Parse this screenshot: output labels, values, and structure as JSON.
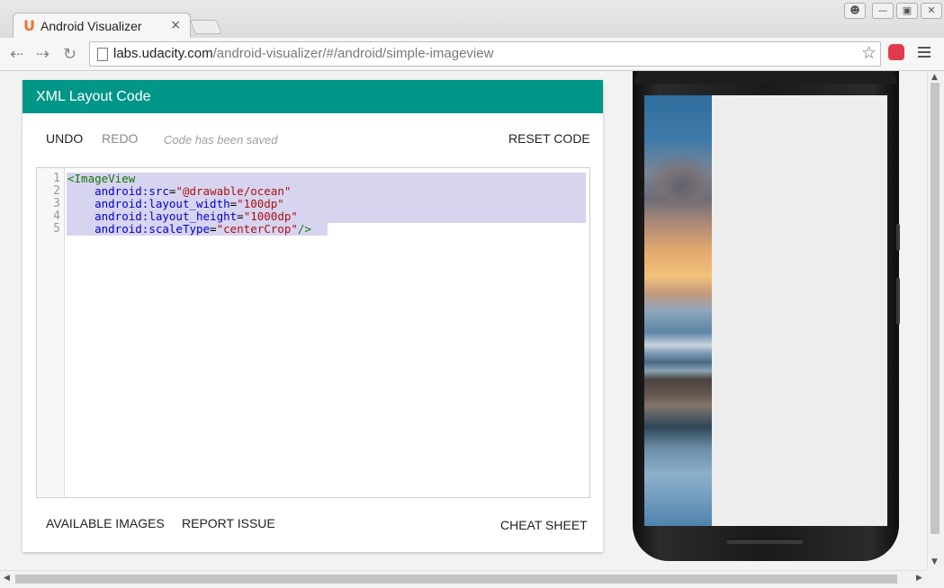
{
  "browser": {
    "tab_title": "Android Visualizer",
    "tab_favicon": "U",
    "tab_close": "×",
    "url_host": "labs.udacity.com",
    "url_path": "/android-visualizer/#/android/simple-imageview"
  },
  "card": {
    "header_title": "XML Layout Code",
    "undo_label": "UNDO",
    "redo_label": "REDO",
    "saved_status": "Code has been saved",
    "reset_label": "RESET CODE",
    "available_images_label": "AVAILABLE IMAGES",
    "report_issue_label": "REPORT ISSUE",
    "cheat_sheet_label": "CHEAT SHEET"
  },
  "editor": {
    "line_numbers": [
      "1",
      "2",
      "3",
      "4",
      "5"
    ],
    "lines": [
      [
        {
          "t": "tag",
          "v": "<ImageView"
        }
      ],
      [
        {
          "t": "plain",
          "v": "    "
        },
        {
          "t": "attr",
          "v": "android:src"
        },
        {
          "t": "plain",
          "v": "="
        },
        {
          "t": "str",
          "v": "\"@drawable/ocean\""
        }
      ],
      [
        {
          "t": "plain",
          "v": "    "
        },
        {
          "t": "attr",
          "v": "android:layout_width"
        },
        {
          "t": "plain",
          "v": "="
        },
        {
          "t": "str",
          "v": "\"100dp\""
        }
      ],
      [
        {
          "t": "plain",
          "v": "    "
        },
        {
          "t": "attr",
          "v": "android:layout_height"
        },
        {
          "t": "plain",
          "v": "="
        },
        {
          "t": "str",
          "v": "\"1000dp\""
        }
      ],
      [
        {
          "t": "plain",
          "v": "    "
        },
        {
          "t": "attr",
          "v": "android:scaleType"
        },
        {
          "t": "plain",
          "v": "="
        },
        {
          "t": "str",
          "v": "\"centerCrop\""
        },
        {
          "t": "tag",
          "v": "/>"
        }
      ]
    ]
  },
  "icons": {
    "back": "back-arrow-icon",
    "forward": "forward-arrow-icon",
    "reload": "reload-icon",
    "page": "page-icon",
    "bookmark": "star-icon",
    "extension": "extension-icon",
    "menu": "hamburger-menu-icon",
    "profile": "user-icon"
  },
  "colors": {
    "header": "#009688",
    "tag": "#117700",
    "attr": "#0000cc",
    "string": "#aa1111",
    "selection": "#d7d4f0"
  }
}
